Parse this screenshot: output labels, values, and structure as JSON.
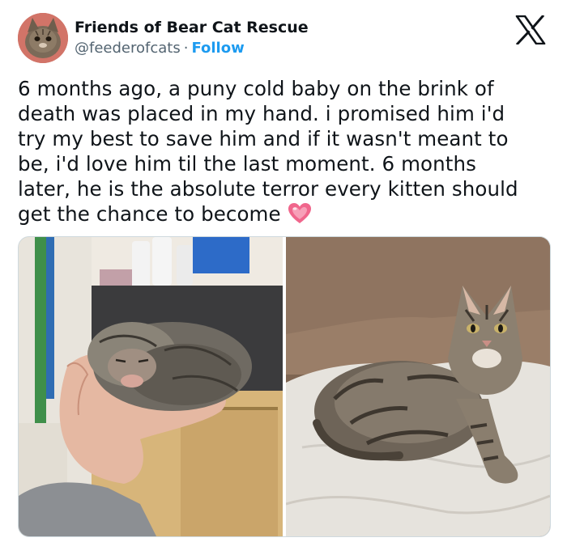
{
  "tweet": {
    "display_name": "Friends of Bear Cat Rescue",
    "handle": "@feederofcats",
    "separator": "·",
    "follow_label": "Follow",
    "text_lines": [
      "6 months ago, a puny cold baby on the brink of",
      "death was placed in my hand. i promised him i'd",
      "try my best to save him and if it wasn't meant to",
      "be, i'd love him til the last moment. 6 months",
      "later, he is the absolute terror every kitten should",
      "get the chance to become"
    ]
  },
  "icons": {
    "platform": "x-logo-icon",
    "emoji": "sparkling-heart-icon"
  },
  "colors": {
    "follow": "#1d9bf0",
    "handle": "#536471",
    "text": "#0f1419",
    "heart": "#f0668c"
  }
}
